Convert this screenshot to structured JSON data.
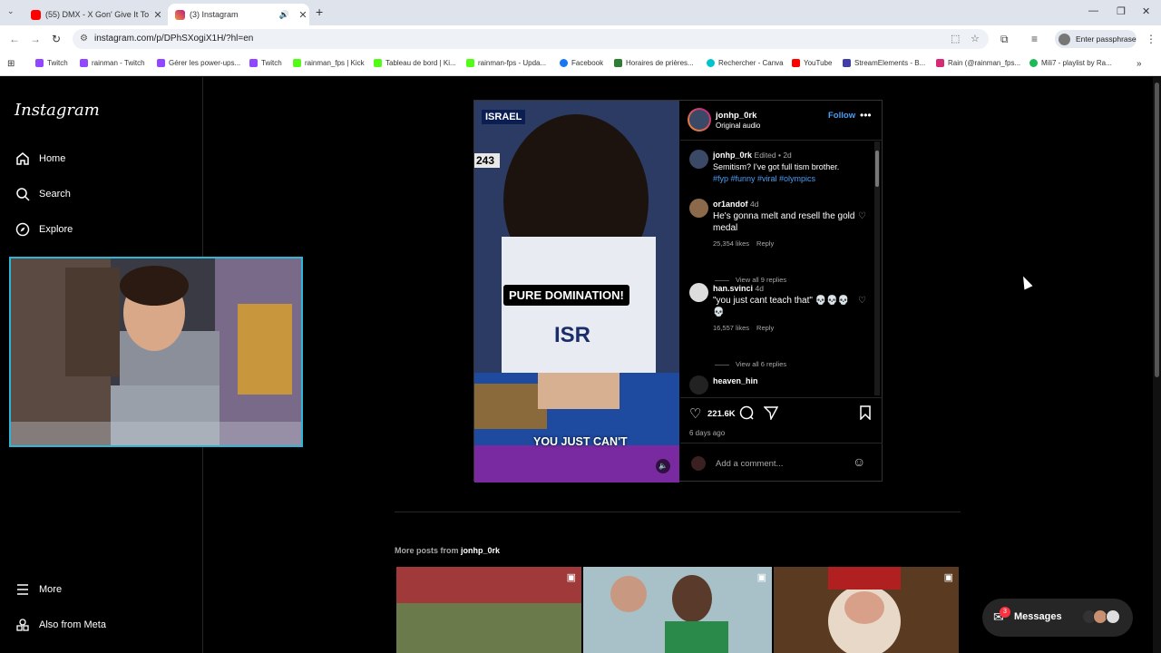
{
  "browser": {
    "tabs": [
      {
        "title": "(55) DMX - X Gon' Give It To Ya",
        "icon": "youtube-icon",
        "color": "#ff0000"
      },
      {
        "title": "(3) Instagram",
        "icon": "instagram-icon",
        "color": "#d62976"
      }
    ],
    "url": "instagram.com/p/DPhSXogiX1H/?hl=en",
    "passphrase_label": "Enter passphrase",
    "bookmarks": [
      {
        "label": "Twitch",
        "color": "#9146ff"
      },
      {
        "label": "rainman - Twitch",
        "color": "#9146ff"
      },
      {
        "label": "Gérer les power-ups...",
        "color": "#9146ff"
      },
      {
        "label": "Twitch",
        "color": "#9146ff"
      },
      {
        "label": "rainman_fps | Kick",
        "color": "#53fc18"
      },
      {
        "label": "Tableau de bord | Ki...",
        "color": "#53fc18"
      },
      {
        "label": "rainman-fps - Upda...",
        "color": "#53fc18"
      },
      {
        "label": "Facebook",
        "color": "#1877f2"
      },
      {
        "label": "Horaires de prières...",
        "color": "#2e7d32"
      },
      {
        "label": "Rechercher - Canva",
        "color": "#00c4cc"
      },
      {
        "label": "YouTube",
        "color": "#ff0000"
      },
      {
        "label": "StreamElements - B...",
        "color": "#3f3fa6"
      },
      {
        "label": "Rain (@rainman_fps...",
        "color": "#d62976"
      },
      {
        "label": "Mili7 - playlist by Ra...",
        "color": "#1db954"
      }
    ]
  },
  "sidebar": {
    "logo": "Instagram",
    "items": [
      {
        "label": "Home",
        "icon": "home-icon"
      },
      {
        "label": "Search",
        "icon": "search-icon"
      },
      {
        "label": "Explore",
        "icon": "explore-icon"
      }
    ],
    "bottom": [
      {
        "label": "More",
        "icon": "menu-icon"
      },
      {
        "label": "Also from Meta",
        "icon": "meta-icon"
      }
    ]
  },
  "post": {
    "author": "jonhp_0rk",
    "audio": "Original audio",
    "follow_label": "Follow",
    "video": {
      "overlay_top": "ISRAEL",
      "score": "243",
      "caption_1": "PURE DOMINATION!",
      "caption_2": "YOU JUST CAN'T",
      "jersey": "ISR"
    },
    "comments": [
      {
        "user": "jonhp_0rk",
        "meta": "Edited • 2d",
        "text": "Semitism? I've got full tism brother.",
        "tags": "#fyp #funny #viral #olympics"
      },
      {
        "user": "or1andof",
        "meta": "4d",
        "text": "He's gonna melt and resell the gold medal",
        "likes": "25,354 likes",
        "reply": "Reply",
        "view_replies": "View all 9 replies"
      },
      {
        "user": "han.svinci",
        "meta": "4d",
        "text": "\"you just cant teach that\" 💀💀💀💀",
        "likes": "16,557 likes",
        "reply": "Reply",
        "view_replies": "View all 6 replies"
      },
      {
        "user": "heaven_hin"
      }
    ],
    "like_count": "221.6K",
    "posted": "6 days ago",
    "add_comment_placeholder": "Add a comment..."
  },
  "more_posts": {
    "label": "More posts from",
    "user": "jonhp_0rk"
  },
  "messages": {
    "label": "Messages",
    "badge": "3"
  }
}
